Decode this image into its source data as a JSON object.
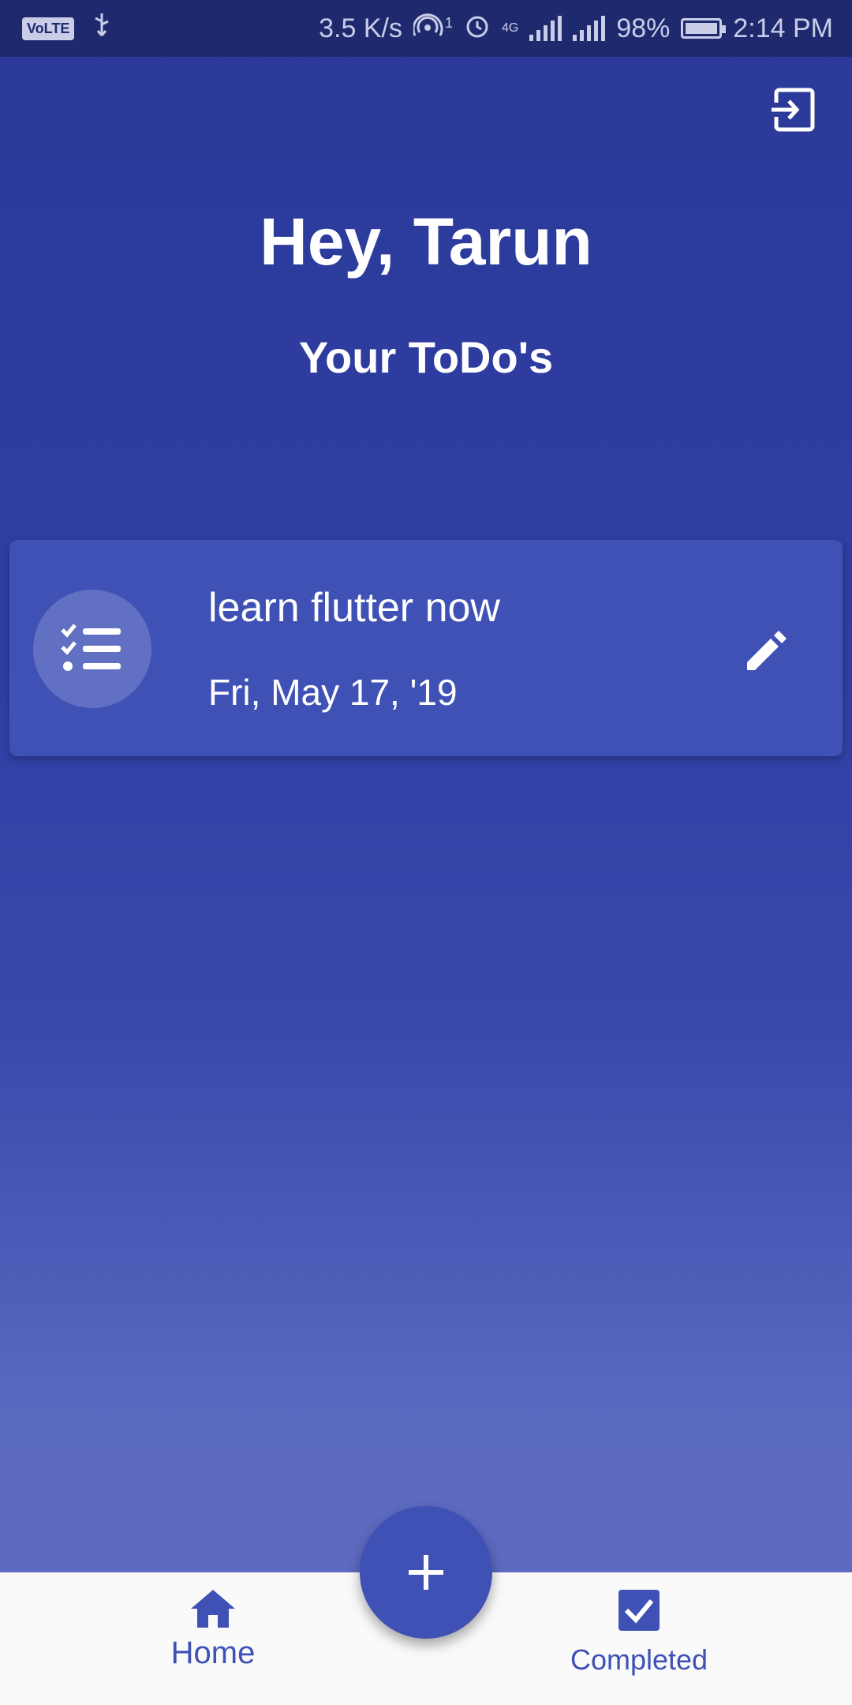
{
  "status_bar": {
    "network_speed": "3.5 K/s",
    "hotspot_count": "1",
    "network_type": "4G",
    "battery": "98%",
    "time": "2:14 PM",
    "icons": [
      "volte-icon",
      "usb-icon",
      "hotspot-icon",
      "alarm-icon",
      "signal-icon",
      "battery-icon"
    ]
  },
  "header": {
    "greeting": "Hey, Tarun",
    "subtitle": "Your ToDo's",
    "logout_icon": "logout-icon"
  },
  "todos": [
    {
      "title": "learn flutter now",
      "date": "Fri, May 17, '19",
      "icon": "checklist-icon",
      "action_icon": "edit-icon"
    }
  ],
  "fab": {
    "icon": "plus-icon"
  },
  "bottom_nav": {
    "home_label": "Home",
    "completed_label": "Completed"
  },
  "colors": {
    "primary": "#3f51b5",
    "background_top": "#2b3a98",
    "background_bottom": "#5f6bc2",
    "status_bar": "#1f2a6e",
    "text": "#ffffff"
  }
}
